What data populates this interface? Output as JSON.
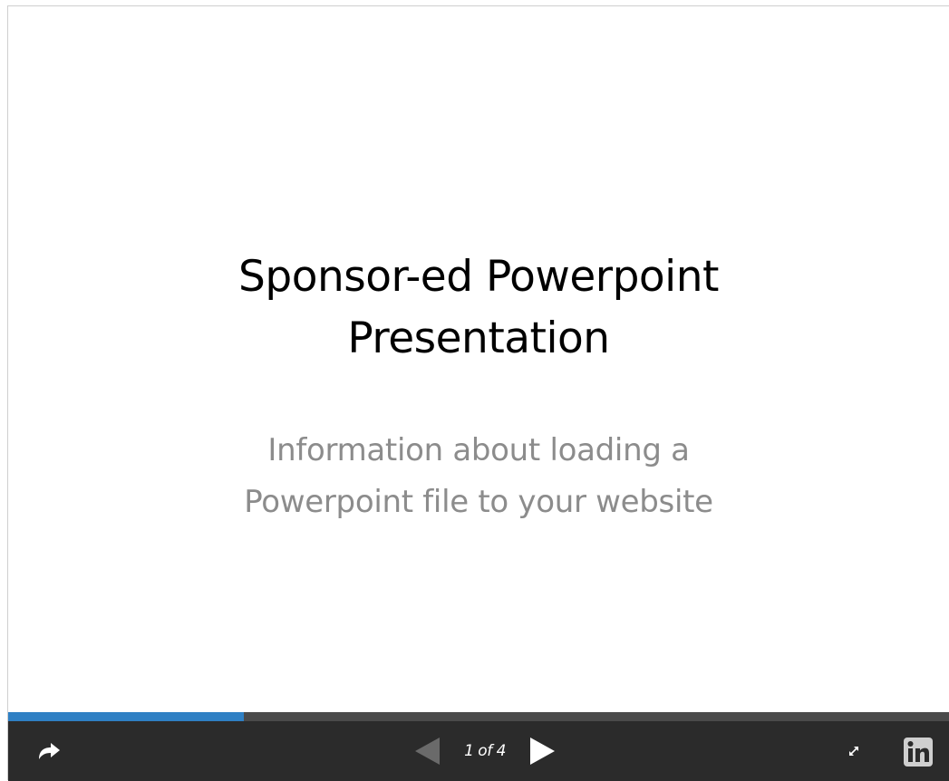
{
  "slide": {
    "title_lines": [
      "Sponsor-ed Powerpoint",
      "Presentation"
    ],
    "subtitle_lines": [
      "Information about loading a",
      "Powerpoint file to your website"
    ]
  },
  "player": {
    "current_slide": 1,
    "total_slides": 4,
    "page_indicator": "1 of 4",
    "progress_fraction": 0.25,
    "colors": {
      "progress_fill": "#2f80c4",
      "progress_track": "#4a4a4a",
      "toolbar_bg": "#2b2b2b",
      "prev_disabled": "#6a6a6a",
      "icon": "#ffffff"
    },
    "icons": {
      "share": "share-arrow-icon",
      "prev": "triangle-left-icon",
      "next": "triangle-right-icon",
      "fullscreen": "expand-arrows-icon",
      "linkedin": "linkedin-logo-icon"
    }
  }
}
